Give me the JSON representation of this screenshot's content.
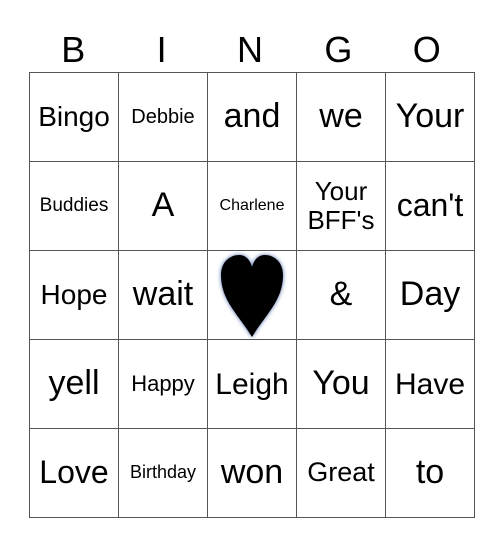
{
  "header": [
    "B",
    "I",
    "N",
    "G",
    "O"
  ],
  "rows": [
    [
      {
        "t": "Bingo",
        "s": 28
      },
      {
        "t": "Debbie",
        "s": 20
      },
      {
        "t": "and",
        "s": 34
      },
      {
        "t": "we",
        "s": 34
      },
      {
        "t": "Your",
        "s": 34
      }
    ],
    [
      {
        "t": "Buddies",
        "s": 19
      },
      {
        "t": "A",
        "s": 34
      },
      {
        "t": "Charlene",
        "s": 16
      },
      {
        "t": "Your BFF's",
        "s": 26
      },
      {
        "t": "can't",
        "s": 32
      }
    ],
    [
      {
        "t": "Hope",
        "s": 28
      },
      {
        "t": "wait",
        "s": 34
      },
      {
        "t": "",
        "s": 0,
        "icon": "heart"
      },
      {
        "t": "&",
        "s": 34
      },
      {
        "t": "Day",
        "s": 34
      }
    ],
    [
      {
        "t": "yell",
        "s": 34
      },
      {
        "t": "Happy",
        "s": 22
      },
      {
        "t": "Leigh",
        "s": 30
      },
      {
        "t": "You",
        "s": 34
      },
      {
        "t": "Have",
        "s": 30
      }
    ],
    [
      {
        "t": "Love",
        "s": 32
      },
      {
        "t": "Birthday",
        "s": 18
      },
      {
        "t": "won",
        "s": 34
      },
      {
        "t": "Great",
        "s": 27
      },
      {
        "t": "to",
        "s": 34
      }
    ]
  ]
}
